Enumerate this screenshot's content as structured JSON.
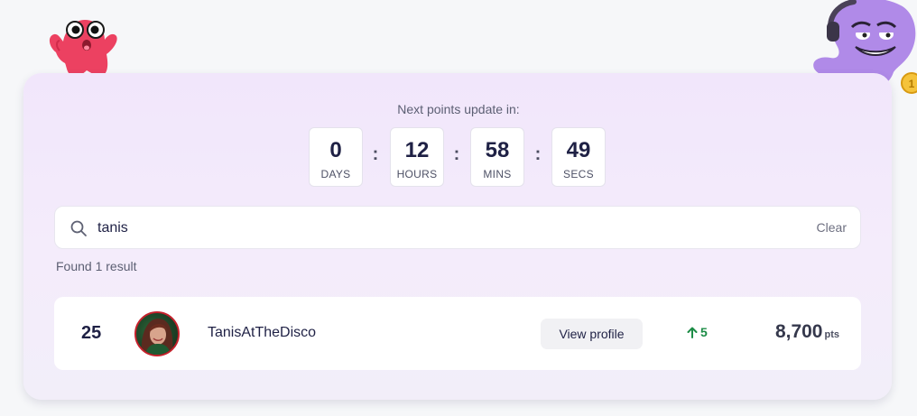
{
  "countdown": {
    "caption": "Next points update in:",
    "units": [
      {
        "value": "0",
        "label": "DAYS"
      },
      {
        "value": "12",
        "label": "HOURS"
      },
      {
        "value": "58",
        "label": "MINS"
      },
      {
        "value": "49",
        "label": "SECS"
      }
    ],
    "separator": ":"
  },
  "search": {
    "icon": "search-icon",
    "value": "tanis",
    "clear_label": "Clear"
  },
  "results": {
    "summary": "Found 1 result",
    "rows": [
      {
        "rank": "25",
        "avatar": "user-avatar",
        "username": "TanisAtTheDisco",
        "view_label": "View profile",
        "change": "5",
        "change_icon": "arrow-up-icon",
        "points": "8,700",
        "points_suffix": "pts"
      }
    ]
  },
  "colors": {
    "panel": "#f1e6fb",
    "accent_up": "#1c8c46",
    "text_dark": "#1f2145"
  },
  "mascots": [
    "pink-blob-mascot",
    "purple-octopus-mascot"
  ]
}
